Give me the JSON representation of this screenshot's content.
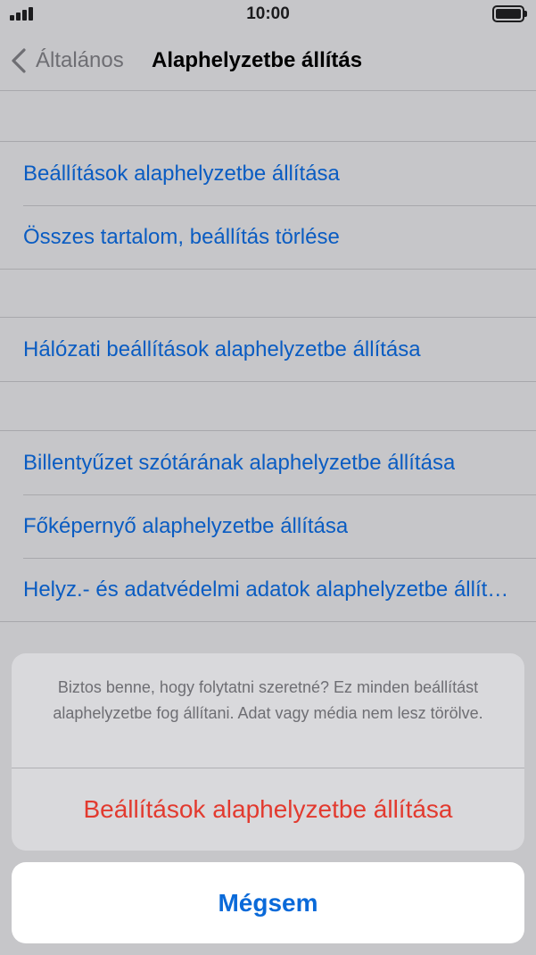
{
  "status_bar": {
    "time": "10:00",
    "signal_icon": "signal-bars-icon",
    "battery_icon": "battery-full-icon"
  },
  "nav": {
    "back_label": "Általános",
    "back_icon": "chevron-left-icon",
    "title": "Alaphelyzetbe állítás"
  },
  "groups": [
    {
      "items": [
        {
          "label": "Beállítások alaphelyzetbe állítása"
        },
        {
          "label": "Összes tartalom, beállítás törlése"
        }
      ]
    },
    {
      "items": [
        {
          "label": "Hálózati beállítások alaphelyzetbe állítása"
        }
      ]
    },
    {
      "items": [
        {
          "label": "Billentyűzet szótárának alaphelyzetbe állítása"
        },
        {
          "label": "Főképernyő alaphelyzetbe állítása"
        },
        {
          "label": "Helyz.- és adatvédelmi adatok alaphelyzetbe állítása"
        }
      ]
    }
  ],
  "action_sheet": {
    "message": "Biztos benne, hogy folytatni szeretné? Ez minden beállítást alaphelyzetbe fog állítani. Adat vagy média nem lesz törölve.",
    "confirm_label": "Beállítások alaphelyzetbe állítása",
    "cancel_label": "Mégsem"
  },
  "colors": {
    "link_blue": "#0a5cc2",
    "destructive_red": "#e23a2f",
    "cancel_blue": "#0a6ad9",
    "dimmed_background": "#c6c6c9"
  }
}
